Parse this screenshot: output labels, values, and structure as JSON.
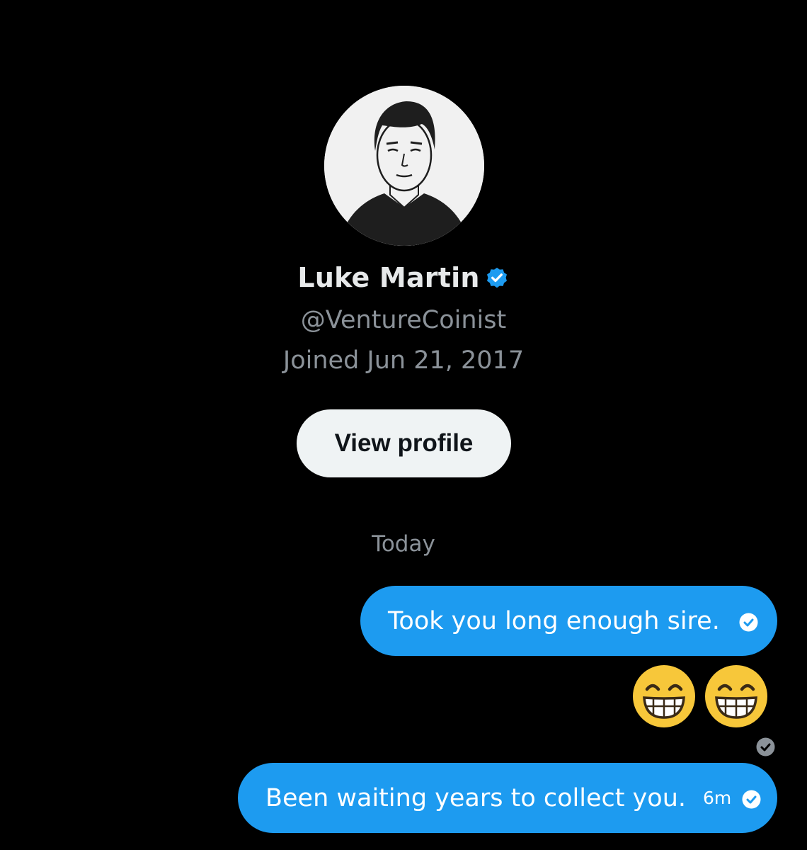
{
  "profile": {
    "name": "Luke Martin",
    "handle": "@VentureCoinist",
    "joined": "Joined Jun 21, 2017",
    "view_profile_label": "View profile",
    "avatar_icon": "avatar-illustration",
    "verified_icon": "verified-badge-icon"
  },
  "conversation": {
    "day_label": "Today",
    "messages": [
      {
        "text": "Took you long enough sire.",
        "time": "",
        "status_icon": "sent-check-icon"
      },
      {
        "emojis": [
          "😁",
          "😁"
        ],
        "status_icon": "sent-check-icon"
      },
      {
        "text": "Been waiting years to collect you.",
        "time": "6m",
        "status_icon": "sent-check-icon"
      }
    ]
  },
  "colors": {
    "background": "#000000",
    "bubble": "#1d9bf0",
    "secondary_text": "#8b9299",
    "button_bg": "#eff3f4"
  }
}
